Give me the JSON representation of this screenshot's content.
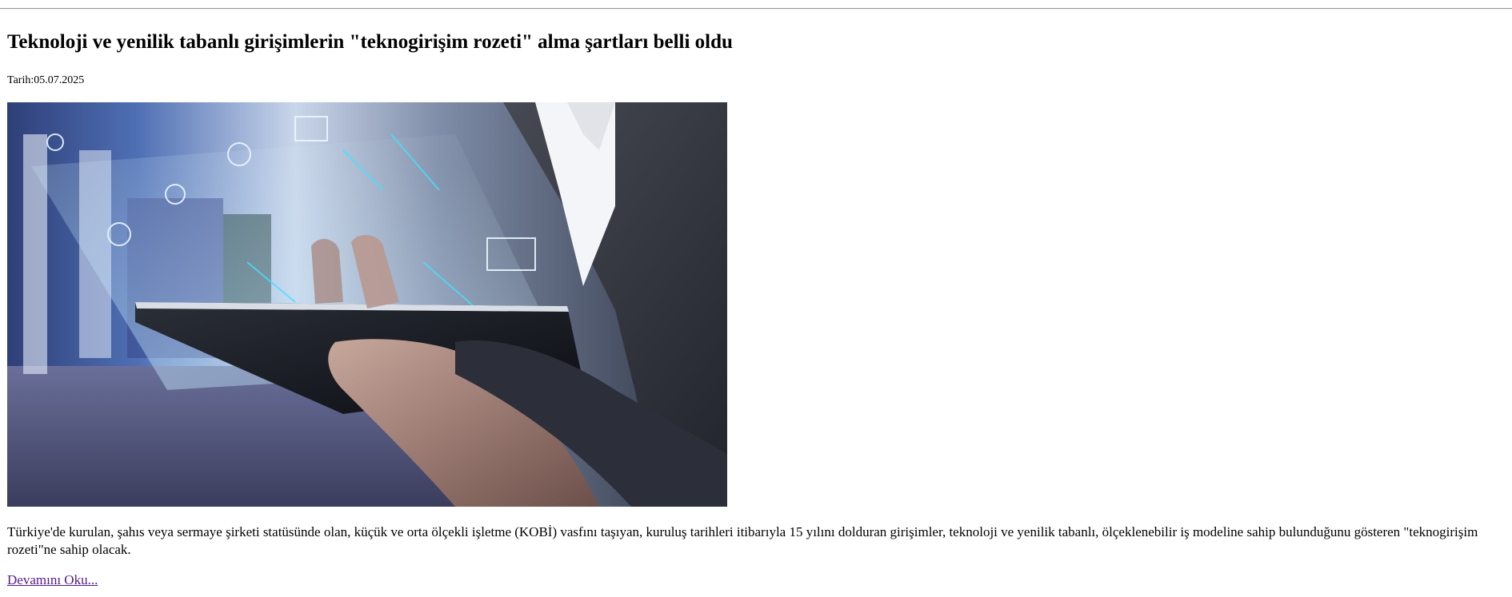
{
  "article": {
    "title": "Teknoloji ve yenilik tabanlı girişimlerin \"teknogirişim rozeti\" alma şartları belli oldu",
    "date": "Tarih:05.07.2025",
    "summary": "Türkiye'de kurulan, şahıs veya sermaye şirketi statüsünde olan, küçük ve orta ölçekli işletme (KOBİ) vasfını taşıyan, kuruluş tarihleri itibarıyla 15 yılını dolduran girişimler, teknoloji ve yenilik tabanlı, ölçeklenebilir iş modeline sahip bulunduğunu gösteren \"teknogirişim rozeti\"ne sahip olacak.",
    "read_more": "Devamını Oku..."
  },
  "colors": {
    "link_visited": "#551a8b",
    "rule": "#9a9a9a"
  }
}
